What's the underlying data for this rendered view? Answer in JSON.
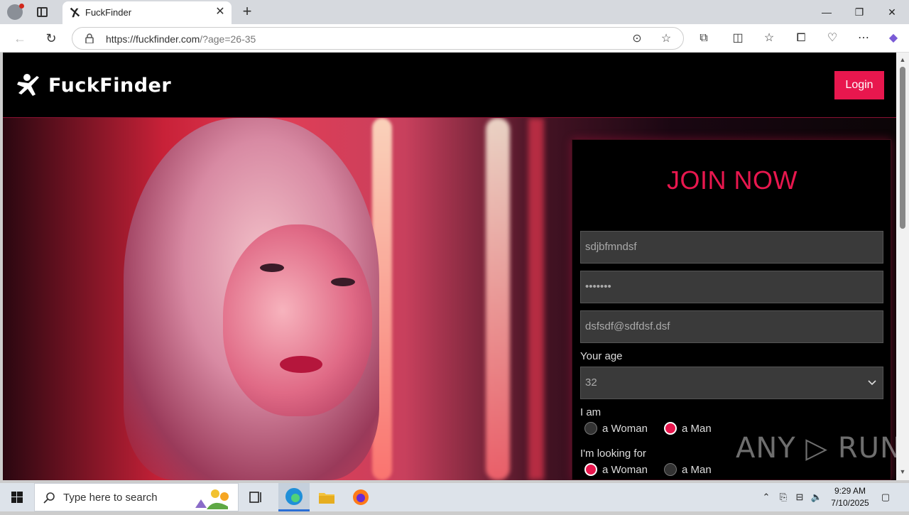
{
  "browser": {
    "tab_title": "FuckFinder",
    "tab_close": "✕",
    "new_tab": "+",
    "url_host": "https://fuckfinder.com",
    "url_rest": "/?age=26-35",
    "minimize": "—",
    "restore": "❐",
    "close": "✕"
  },
  "site": {
    "logo_text": "FuckFinder",
    "login_label": "Login",
    "accent_color": "#e8174e"
  },
  "form": {
    "title": "JOIN NOW",
    "username_value": "sdjbfmndsf",
    "password_value": "•••••••",
    "email_value": "dsfsdf@sdfdsf.dsf",
    "age_label": "Your age",
    "age_value": "32",
    "i_am_label": "I am",
    "looking_for_label": "I'm looking for",
    "i_am_options": [
      {
        "label": "a Woman",
        "checked": false
      },
      {
        "label": "a Man",
        "checked": true
      }
    ],
    "looking_for_options": [
      {
        "label": "a Woman",
        "checked": true
      },
      {
        "label": "a Man",
        "checked": false
      }
    ]
  },
  "watermark": "ANY ▷ RUN",
  "taskbar": {
    "search_placeholder": "Type here to search",
    "time": "9:29 AM",
    "date": "7/10/2025"
  }
}
